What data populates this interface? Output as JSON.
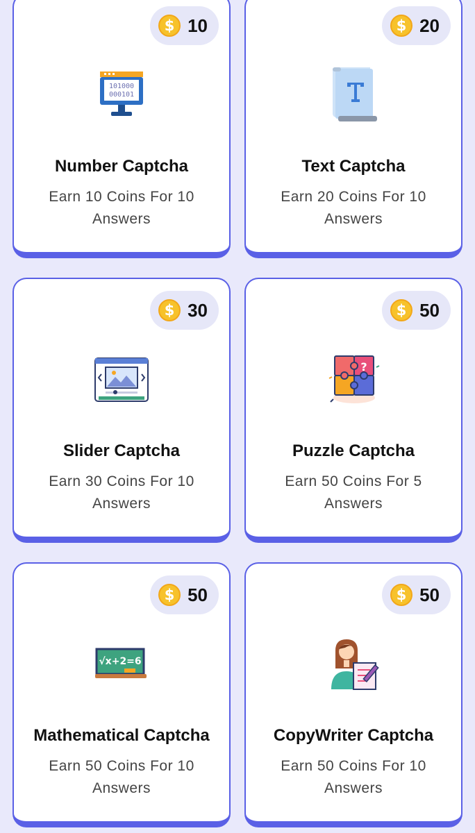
{
  "cards": [
    {
      "coins": "10",
      "title": "Number Captcha",
      "description": "Earn 10 Coins For 10 Answers",
      "icon": "binary-monitor-icon"
    },
    {
      "coins": "20",
      "title": "Text Captcha",
      "description": "Earn 20 Coins For 10 Answers",
      "icon": "text-scroll-icon"
    },
    {
      "coins": "30",
      "title": "Slider Captcha",
      "description": "Earn 30 Coins For 10 Answers",
      "icon": "image-slider-icon"
    },
    {
      "coins": "50",
      "title": "Puzzle Captcha",
      "description": "Earn 50 Coins For 5 Answers",
      "icon": "puzzle-icon"
    },
    {
      "coins": "50",
      "title": "Mathematical Captcha",
      "description": "Earn 50 Coins For 10 Answers",
      "icon": "chalkboard-icon"
    },
    {
      "coins": "50",
      "title": "CopyWriter Captcha",
      "description": "Earn 50 Coins For 10 Answers",
      "icon": "writer-icon"
    }
  ],
  "coin_symbol": "$",
  "colors": {
    "background": "#e9e9fb",
    "accent": "#5a60e6",
    "badge": "#e6e7f8",
    "coin": "#f7c22b"
  }
}
